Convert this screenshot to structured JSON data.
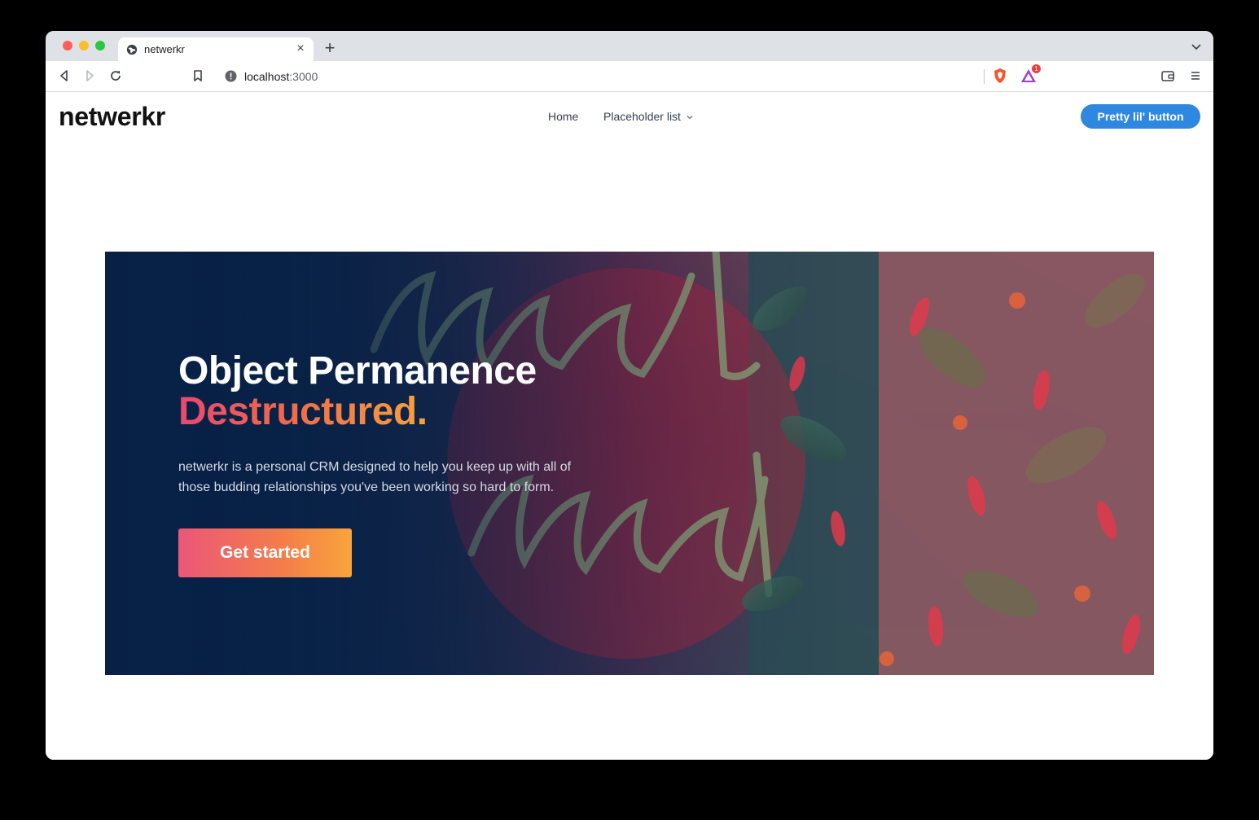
{
  "browser": {
    "tab_title": "netwerkr",
    "tab_close": "×",
    "new_tab": "+",
    "url_host": "localhost",
    "url_port": ":3000",
    "shield_badge_count": "1"
  },
  "header": {
    "logo": "netwerkr",
    "nav": [
      {
        "label": "Home"
      },
      {
        "label": "Placeholder list"
      }
    ],
    "cta_label": "Pretty lil' button"
  },
  "hero": {
    "title_line1": "Object Permanence",
    "title_line2": "Destructured.",
    "description": "netwerkr is a personal CRM designed to help you keep up with all of those budding relationships you've been working so hard to form.",
    "button_label": "Get started"
  },
  "colors": {
    "accent_blue": "#2f88e0",
    "gradient_start": "#e8486f",
    "gradient_end": "#f7a33a",
    "hero_dark": "#0b2347"
  }
}
